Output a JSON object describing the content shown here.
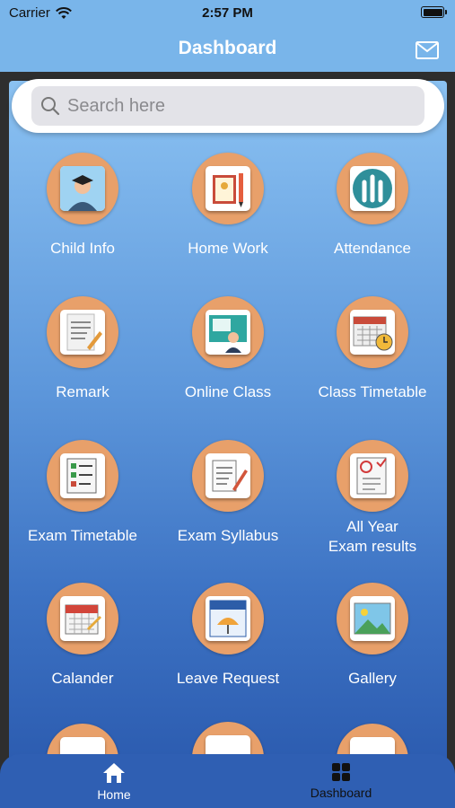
{
  "status_bar": {
    "carrier": "Carrier",
    "time": "2:57 PM"
  },
  "header": {
    "title": "Dashboard"
  },
  "search": {
    "placeholder": "Search here"
  },
  "tiles": [
    {
      "label": "Child Info"
    },
    {
      "label": "Home Work"
    },
    {
      "label": "Attendance"
    },
    {
      "label": "Remark"
    },
    {
      "label": "Online Class"
    },
    {
      "label": "Class Timetable"
    },
    {
      "label": "Exam Timetable"
    },
    {
      "label": "Exam Syllabus"
    },
    {
      "label": "All Year"
    },
    {
      "label": "Calander"
    },
    {
      "label": "Leave Request"
    },
    {
      "label": "Gallery"
    }
  ],
  "tile_extra": {
    "exam_results_line2": "Exam results"
  },
  "tabs": {
    "home": "Home",
    "dashboard": "Dashboard"
  },
  "colors": {
    "header_bg": "#79b5ea",
    "icon_circle": "#e8a06a",
    "tabbar_bg": "#2f5fb3"
  },
  "icons": [
    "wifi-icon",
    "battery-icon",
    "mail-icon",
    "search-icon",
    "home-icon",
    "grid-icon"
  ]
}
